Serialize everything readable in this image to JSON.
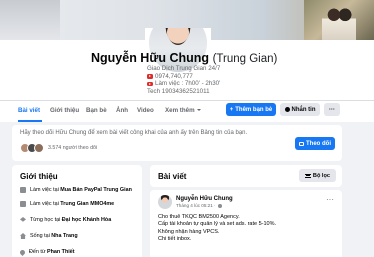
{
  "profile": {
    "name": "Nguyễn Hữu Chung",
    "alternate_name": "(Trung Gian)",
    "bio_lines": [
      "Giao Dịch Trung Gian 24/7",
      "0974,740,777",
      "Làm việc : 7h00' - 2h30'",
      "Tech 19034362521011"
    ],
    "buttons": {
      "add_friend": "Thêm bạn bè",
      "message": "Nhắn tin",
      "more": "···"
    }
  },
  "tabs": [
    {
      "label": "Bài viết",
      "active": true
    },
    {
      "label": "Giới thiệu",
      "active": false
    },
    {
      "label": "Bạn bè",
      "active": false
    },
    {
      "label": "Ảnh",
      "active": false
    },
    {
      "label": "Video",
      "active": false
    },
    {
      "label": "Xem thêm",
      "active": false
    }
  ],
  "tabs_more": "···",
  "follow": {
    "prompt": "Hãy theo dõi Hữu Chung để xem bài viết công khai của anh ấy trên Bảng tin của bạn.",
    "followers": "3.574 người theo dõi",
    "button": "Theo dõi"
  },
  "intro": {
    "title": "Giới thiệu",
    "items": [
      {
        "icon": "briefcase-icon",
        "prefix": "Làm việc tại ",
        "bold": "Mua Bán PayPal Trung Gian"
      },
      {
        "icon": "briefcase-icon",
        "prefix": "Làm việc tại ",
        "bold": "Trung Gian MMO4me"
      },
      {
        "icon": "graduation-cap-icon",
        "prefix": "Từng học tại ",
        "bold": "Đại học Khánh Hòa"
      },
      {
        "icon": "home-icon",
        "prefix": "Sống tại ",
        "bold": "Nha Trang"
      },
      {
        "icon": "location-pin-icon",
        "prefix": "Đến từ ",
        "bold": "Phan Thiết"
      }
    ]
  },
  "posts": {
    "title": "Bài viết",
    "filter_label": "Bộ lọc"
  },
  "post": {
    "author": "Nguyễn Hữu Chung",
    "time": "Tháng 4 lúc 05:21 ·",
    "more": "···",
    "lines": [
      "Cho thuê TKQC BM2500 Agency.",
      "Cấp tài khoản tự quản lý và set ads. rate 5-10%.",
      "Không nhận hàng VPCS.",
      "Chi tiết inbox."
    ]
  },
  "colors": {
    "accent": "#1877f2",
    "background": "#f0f2f5",
    "card": "#ffffff",
    "muted_text": "#65676b"
  }
}
